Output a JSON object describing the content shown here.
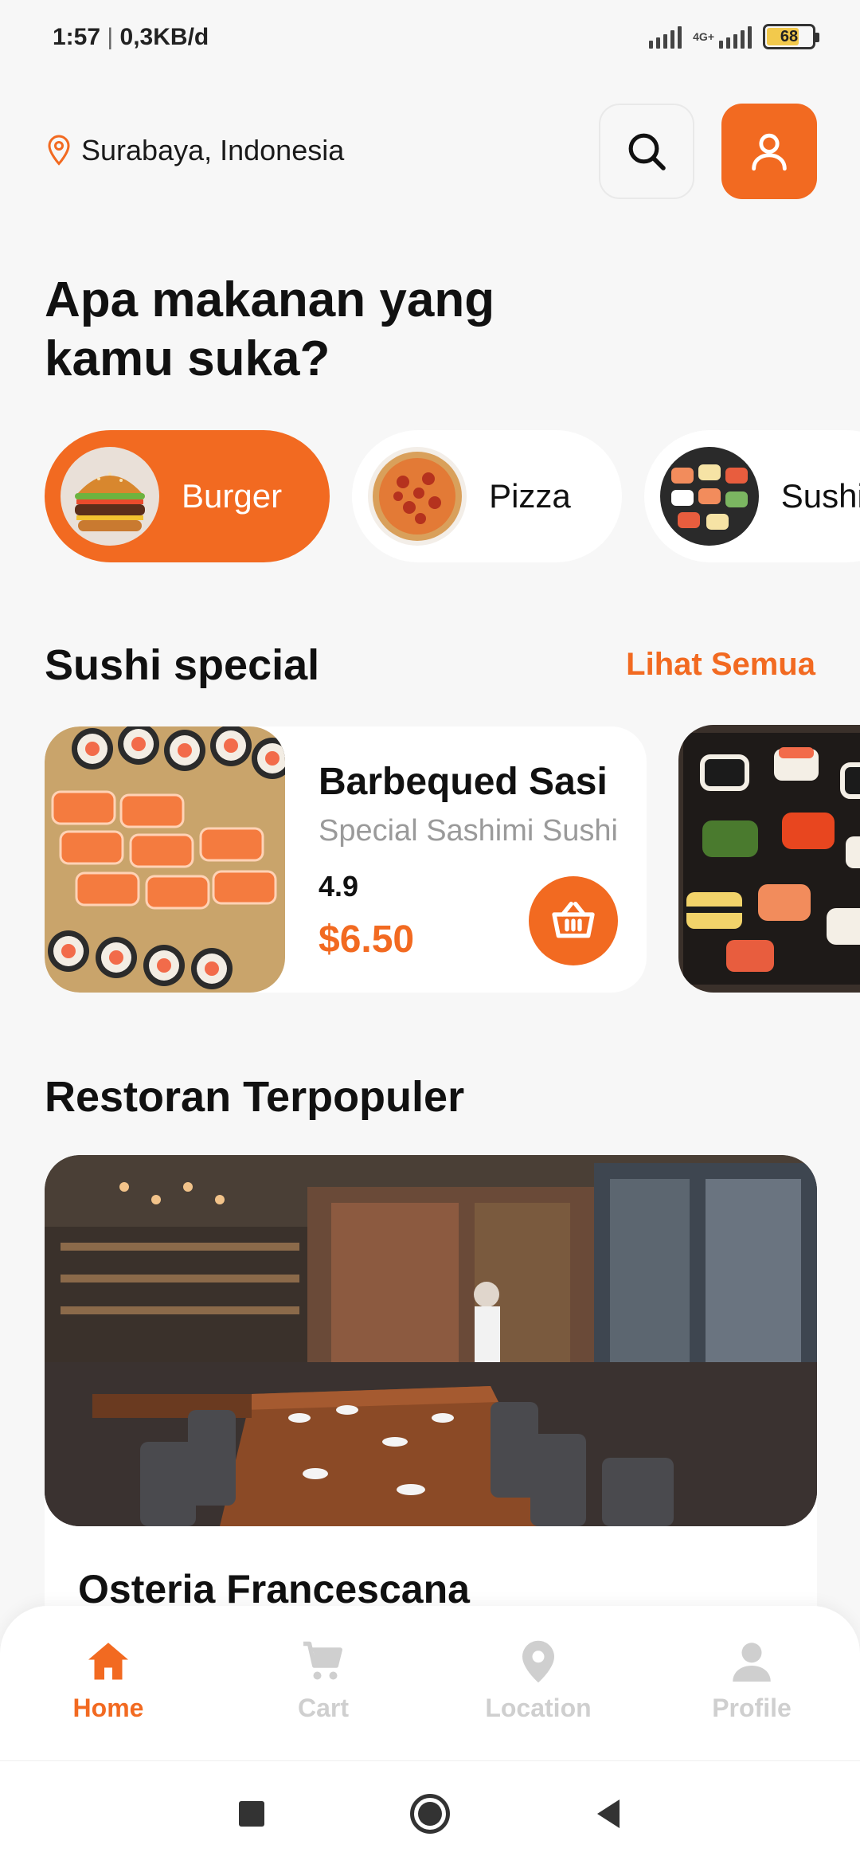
{
  "status_bar": {
    "time": "1:57",
    "speed": "0,3KB/d",
    "network": "4G+",
    "battery": "68"
  },
  "header": {
    "location": "Surabaya, Indonesia",
    "search_icon": "search-icon",
    "profile_icon": "user-icon"
  },
  "headline": "Apa makanan yang kamu suka?",
  "categories": [
    {
      "name": "Burger",
      "active": true,
      "icon": "burger-image"
    },
    {
      "name": "Pizza",
      "active": false,
      "icon": "pizza-image"
    },
    {
      "name": "Sushi",
      "active": false,
      "icon": "sushi-image"
    }
  ],
  "sushi_section": {
    "title": "Sushi special",
    "see_all": "Lihat Semua",
    "cards": [
      {
        "title": "Barbequed Sasi",
        "subtitle": "Special Sashimi Sushi",
        "rating": "4.9",
        "price": "$6.50"
      }
    ]
  },
  "restaurant_section": {
    "title": "Restoran Terpopuler",
    "restaurants": [
      {
        "name": "Osteria Francescana"
      }
    ]
  },
  "bottom_nav": [
    {
      "label": "Home",
      "icon": "home-icon",
      "active": true
    },
    {
      "label": "Cart",
      "icon": "cart-icon",
      "active": false
    },
    {
      "label": "Location",
      "icon": "location-pin-icon",
      "active": false
    },
    {
      "label": "Profile",
      "icon": "profile-icon",
      "active": false
    }
  ],
  "colors": {
    "accent": "#F26A21",
    "background": "#F7F7F7",
    "inactive": "#CFCFCF"
  }
}
